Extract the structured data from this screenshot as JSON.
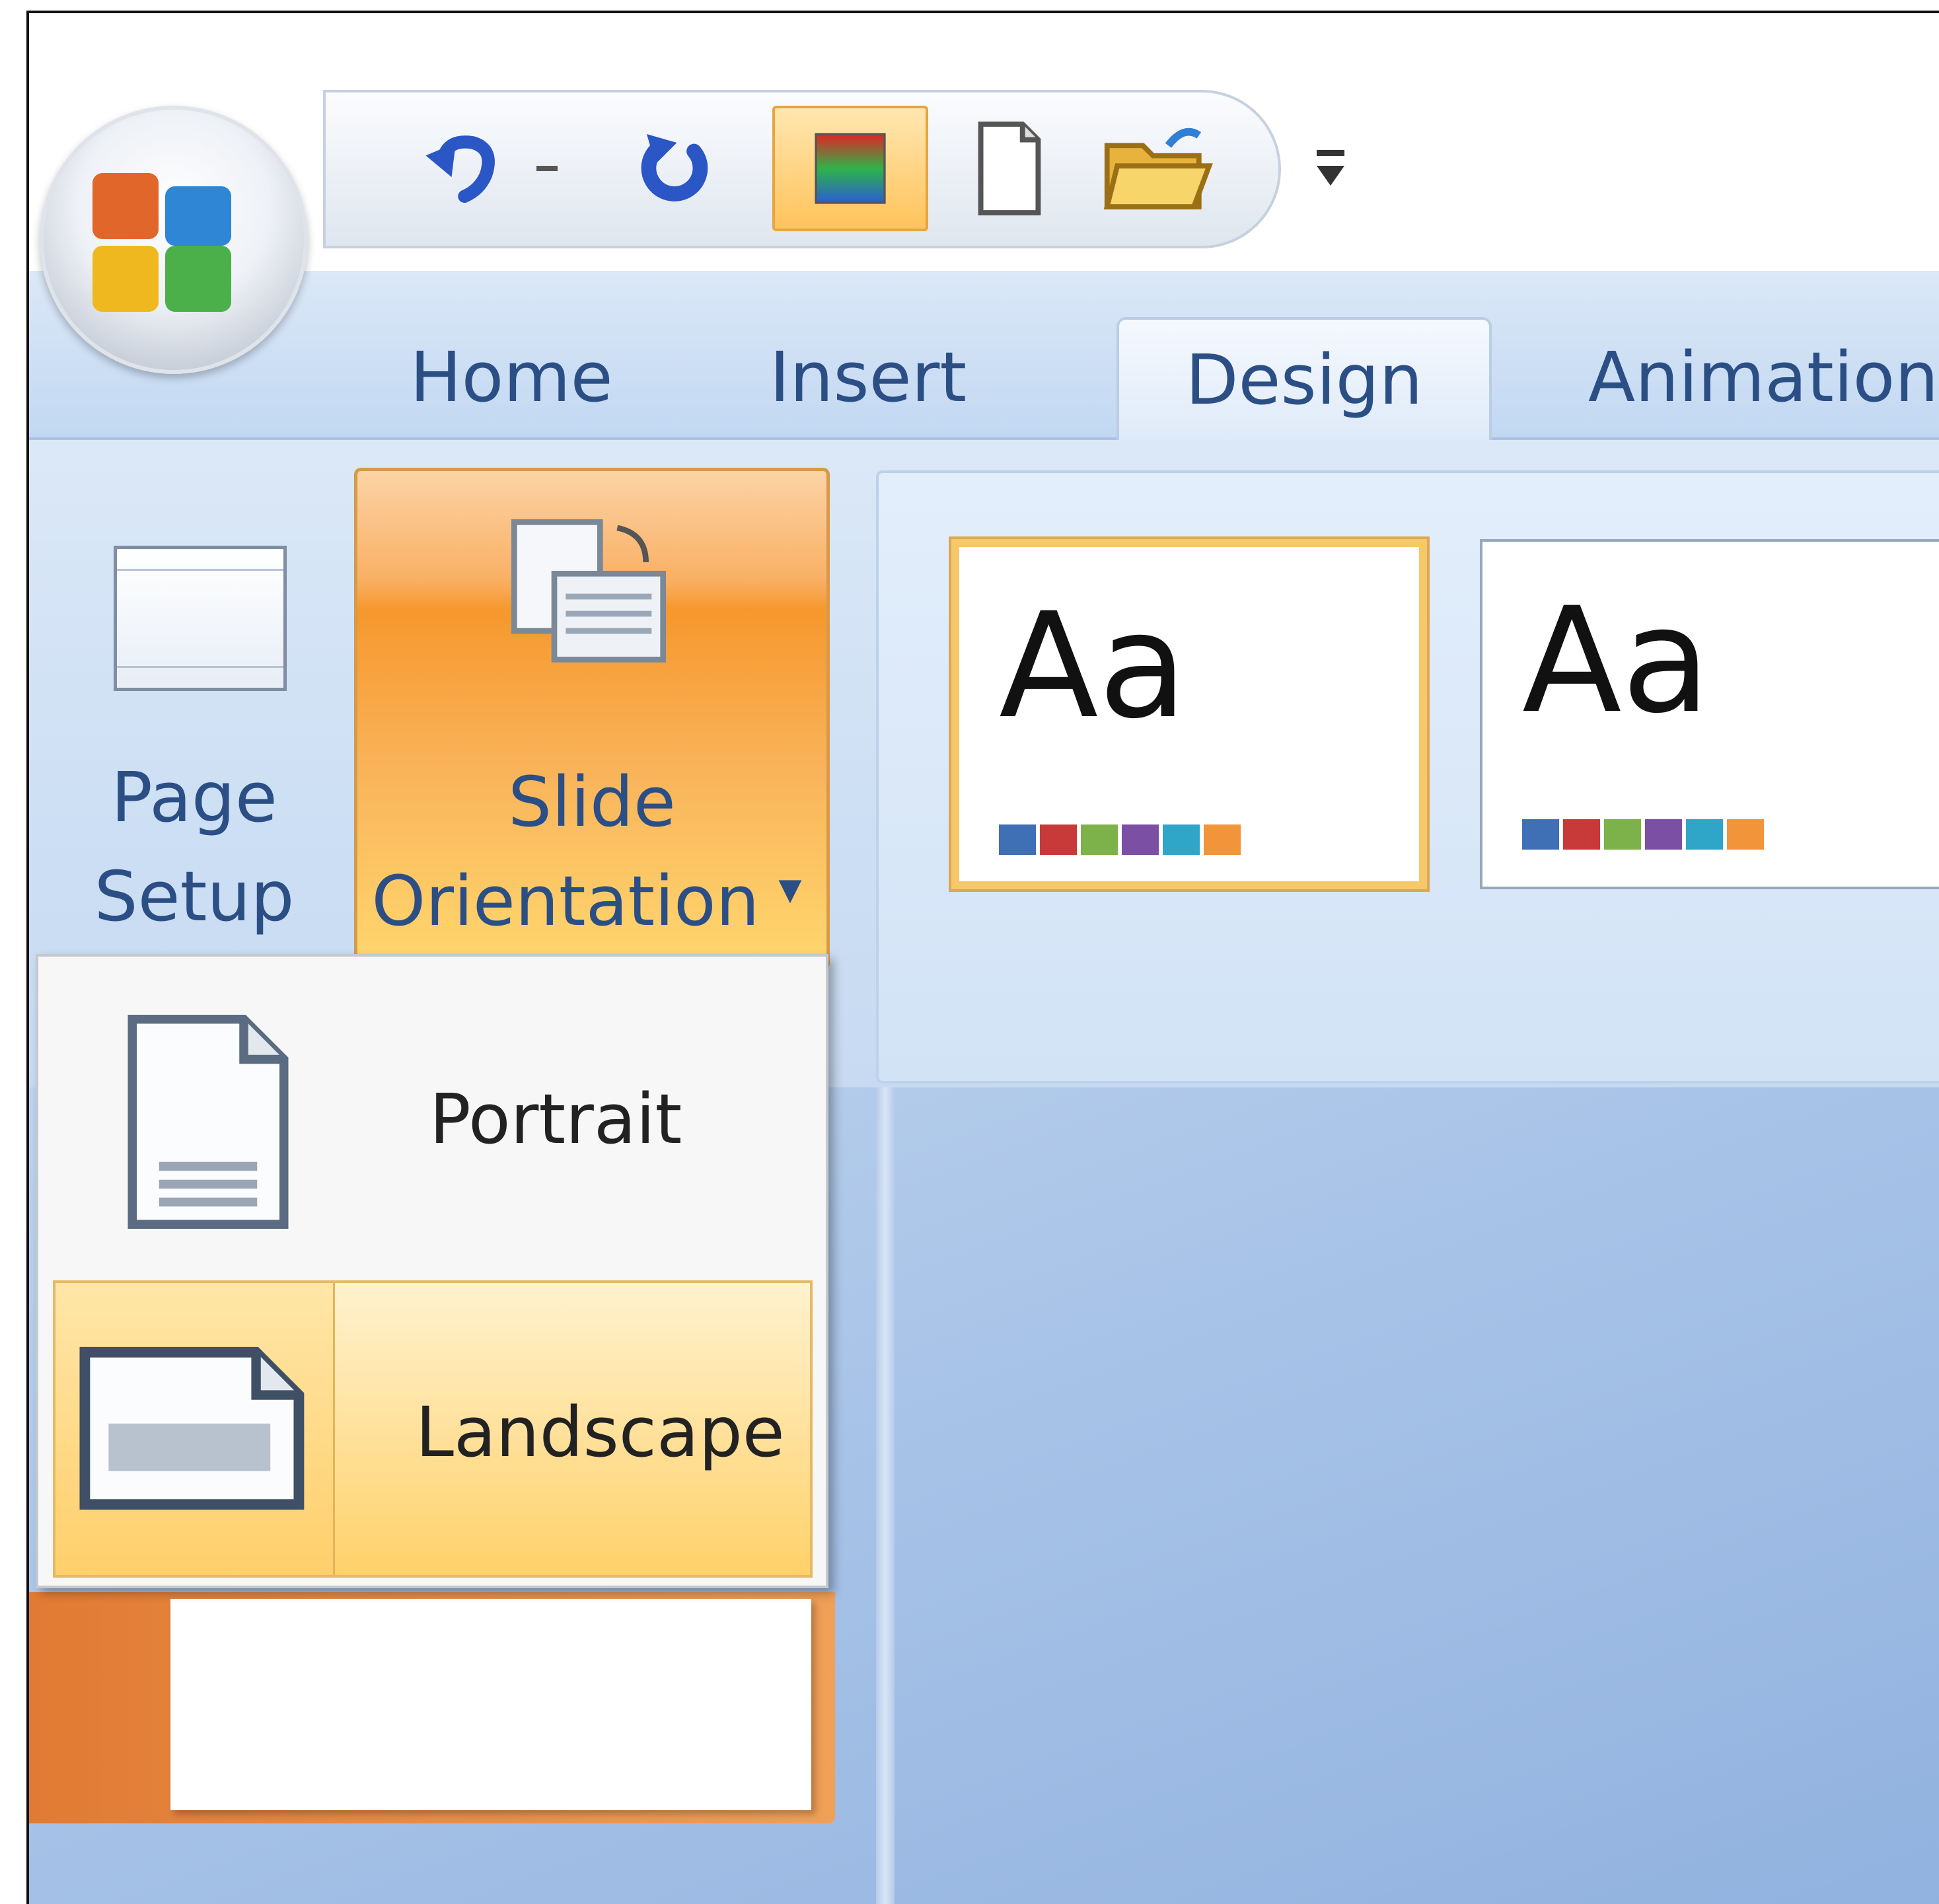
{
  "quick_access": {
    "undo": "undo-icon",
    "undo_dropdown": "dropdown-arrow-icon",
    "redo": "redo-icon",
    "color": "color-scheme-icon",
    "new": "new-document-icon",
    "open": "open-folder-icon",
    "customize": "customize-qat-icon"
  },
  "tabs": [
    {
      "label": "Home"
    },
    {
      "label": "Insert"
    },
    {
      "label": "Design"
    },
    {
      "label": "Animation"
    }
  ],
  "active_tab": "Design",
  "ribbon": {
    "page_setup": {
      "line1": "Page",
      "line2": "Setup"
    },
    "slide_orientation": {
      "line1": "Slide",
      "line2": "Orientation",
      "arrow": "▾"
    }
  },
  "themes": [
    {
      "text": "Aa",
      "selected": true
    },
    {
      "text": "Aa",
      "selected": false
    }
  ],
  "theme_swatch_colors": [
    "#3f6fb5",
    "#c83a3a",
    "#7db24a",
    "#7b4fa3",
    "#2fa6c8",
    "#f2943a"
  ],
  "orientation_menu": {
    "items": [
      {
        "label": "Portrait",
        "highlighted": false
      },
      {
        "label": "Landscape",
        "highlighted": true
      }
    ]
  },
  "colors": {
    "ribbon_blue": "#c2d8f2",
    "tab_text": "#2b4f85",
    "highlight_orange": "#f6982d",
    "menu_highlight": "#ffd16a"
  }
}
